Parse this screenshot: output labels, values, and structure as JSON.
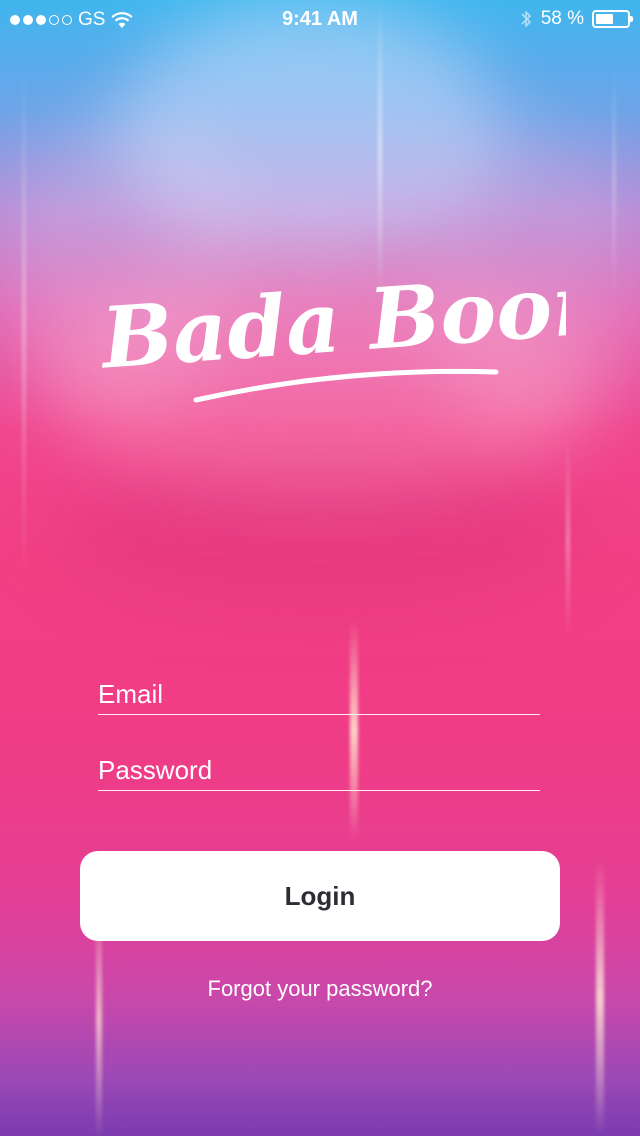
{
  "status_bar": {
    "carrier": "GS",
    "time": "9:41 AM",
    "battery_text": "58 %",
    "battery_level": 0.58,
    "signal_bars_filled": 3,
    "signal_bars_total": 5
  },
  "logo": {
    "text": "Bada Boom"
  },
  "form": {
    "email_placeholder": "Email",
    "password_placeholder": "Password",
    "login_label": "Login",
    "forgot_label": "Forgot your password?"
  },
  "colors": {
    "top": "#3fb6ee",
    "middle": "#f23f84",
    "bottom": "#7c3bb0",
    "button_text": "#2d2d33",
    "button_bg": "#ffffff"
  },
  "icons": {
    "wifi": "wifi-icon",
    "bluetooth": "bluetooth-icon",
    "battery": "battery-icon"
  }
}
